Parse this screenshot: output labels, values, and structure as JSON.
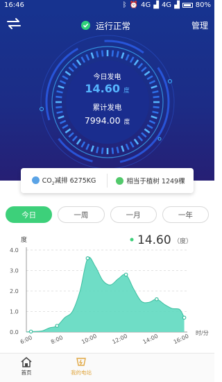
{
  "status_bar": {
    "time": "16:46",
    "network1": "4G",
    "network2": "4G",
    "battery": "80%"
  },
  "header": {
    "status_text": "运行正常",
    "manage_label": "管理"
  },
  "gauge": {
    "today_label": "今日发电",
    "today_value": "14.60",
    "today_unit": "度",
    "total_label": "累计发电",
    "total_value": "7994.00",
    "total_unit": "度"
  },
  "card": {
    "co2_prefix": "CO",
    "co2_sub": "2",
    "co2_text": "减排 6275KG",
    "tree_text": "相当于植树 1249棵"
  },
  "tabs": [
    {
      "label": "今日"
    },
    {
      "label": "一周"
    },
    {
      "label": "一月"
    },
    {
      "label": "一年"
    }
  ],
  "readout": {
    "value": "14.60",
    "unit": "（度）"
  },
  "colors": {
    "accent": "#3dd07a",
    "fill": "#5fd9c0",
    "hero": "#17338f",
    "bottom_active": "#e0a640"
  },
  "chart_data": {
    "type": "area",
    "ylabel": "度",
    "xlabel": "时/分",
    "ylim": [
      0,
      4.0
    ],
    "yticks": [
      "0.0",
      "1.0",
      "2.0",
      "3.0",
      "4.0"
    ],
    "xticks": [
      "6:00",
      "8:00",
      "10:00",
      "12:00",
      "14:00",
      "16:00"
    ],
    "x": [
      6,
      6.3,
      7,
      7.5,
      8,
      8.5,
      9,
      9.5,
      10,
      10.5,
      11,
      11.5,
      12,
      12.5,
      13,
      13.5,
      14,
      14.5,
      15,
      15.5,
      16,
      16.3
    ],
    "values": [
      0,
      0.02,
      0.05,
      0.2,
      0.3,
      0.7,
      1.0,
      2.0,
      3.6,
      3.2,
      2.5,
      2.3,
      2.6,
      2.8,
      2.1,
      1.5,
      1.45,
      1.6,
      1.35,
      1.15,
      1.1,
      0.7
    ],
    "markers": [
      [
        6.3,
        0.02
      ],
      [
        8,
        0.3
      ],
      [
        10,
        3.6
      ],
      [
        12.5,
        2.8
      ],
      [
        14.5,
        1.6
      ],
      [
        16.3,
        0.7
      ]
    ]
  },
  "bottom_nav": [
    {
      "label": "首页",
      "icon": "home-icon"
    },
    {
      "label": "我的电站",
      "icon": "station-icon"
    }
  ]
}
